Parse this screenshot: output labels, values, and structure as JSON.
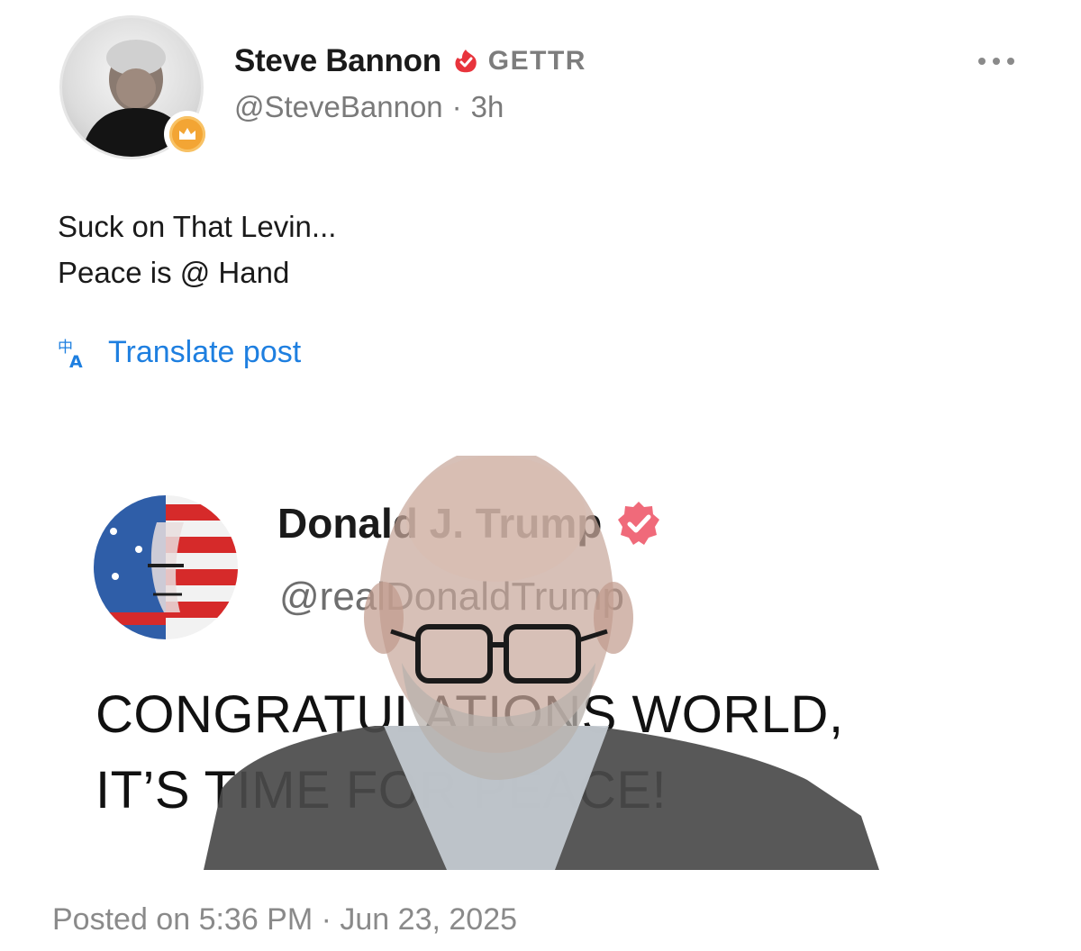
{
  "post": {
    "author_name": "Steve Bannon",
    "platform_label": "GETTR",
    "handle": "@SteveBannon",
    "separator": "·",
    "age": "3h",
    "text_lines": [
      "Suck on That Levin...",
      "Peace is @ Hand"
    ],
    "translate_label": "Translate post",
    "posted_label": "Posted on 5:36 PM · Jun 23, 2025"
  },
  "embedded": {
    "author_name": "Donald J. Trump",
    "handle": "@realDonaldTrump",
    "text_lines": [
      "CONGRATULATIONS WORLD,",
      "IT’S TIME FOR PEACE!"
    ]
  },
  "icons": {
    "verified": "flame-check-icon",
    "badge": "crown-badge-icon",
    "more": "more-dots-icon",
    "translate": "translate-icon",
    "embedded_verified": "verified-badge-icon"
  },
  "colors": {
    "link": "#1e7fe0",
    "verified_red": "#e8343c",
    "badge_orange": "#f3a534",
    "muted": "#7a7a7a"
  }
}
